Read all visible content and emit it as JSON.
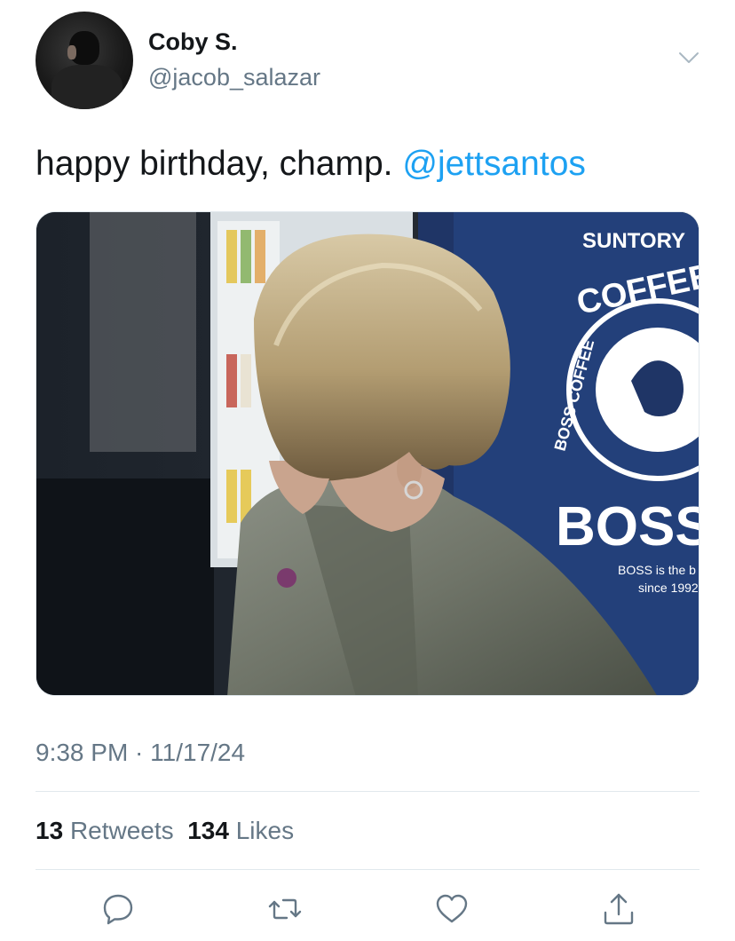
{
  "author": {
    "name": "Coby S.",
    "handle": "@jacob_salazar"
  },
  "tweet": {
    "text": "happy birthday, champ.",
    "mention": "@jettsantos",
    "timestamp": "9:38 PM · 11/17/24"
  },
  "photo": {
    "sign_brand": "SUNTORY",
    "sign_coffee": "COFFEE",
    "sign_ring": "BOSS COFFEE",
    "sign_boss": "BOSS",
    "sign_tagline_1": "BOSS is the b",
    "sign_tagline_2": "since 1992"
  },
  "stats": {
    "retweets_count": "13",
    "retweets_label": "Retweets",
    "likes_count": "134",
    "likes_label": "Likes"
  },
  "colors": {
    "link": "#1da1f2",
    "secondary_text": "#657786",
    "primary_text": "#14171a",
    "divider": "#e1e8ed"
  },
  "icons": [
    "chevron-down-icon",
    "reply-icon",
    "retweet-icon",
    "like-icon",
    "share-icon"
  ]
}
